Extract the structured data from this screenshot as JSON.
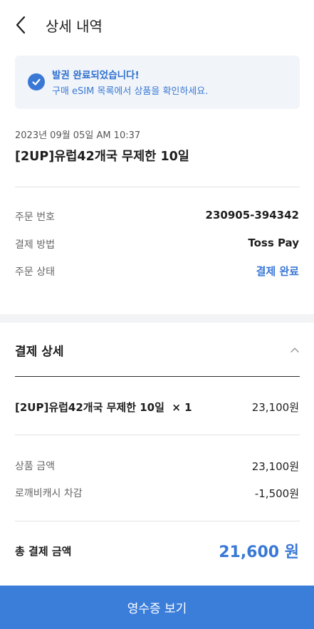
{
  "header": {
    "title": "상세 내역",
    "back_icon": "chevron-left-icon"
  },
  "notice": {
    "icon": "check-circle-icon",
    "title": "발권 완료되었습니다!",
    "subtitle": "구매 eSIM 목록에서 상품을 확인하세요.",
    "accent": "#3a78d6",
    "background": "#f1f5f9"
  },
  "order": {
    "datetime": "2023년 09월 05일 AM 10:37",
    "product": "[2UP]유럽42개국 무제한 10일",
    "rows": [
      {
        "label": "주문 번호",
        "value": "230905-394342"
      },
      {
        "label": "결제 방법",
        "value": "Toss Pay"
      },
      {
        "label": "주문 상태",
        "value": "결제 완료"
      }
    ]
  },
  "payment": {
    "title": "결제 상세",
    "collapse_icon": "chevron-up-icon",
    "item": {
      "name": "[2UP]유럽42개국 무제한 10일",
      "qty": "× 1",
      "price": "23,100원"
    },
    "amounts": [
      {
        "label": "상품 금액",
        "value": "23,100원"
      },
      {
        "label": "로깨비캐시 차감",
        "value": "-1,500원"
      }
    ],
    "total_label": "총 결제 금액",
    "total_value": "21,600 원"
  },
  "footer": {
    "button_label": "영수증 보기",
    "button_color": "#3b7ed9"
  }
}
